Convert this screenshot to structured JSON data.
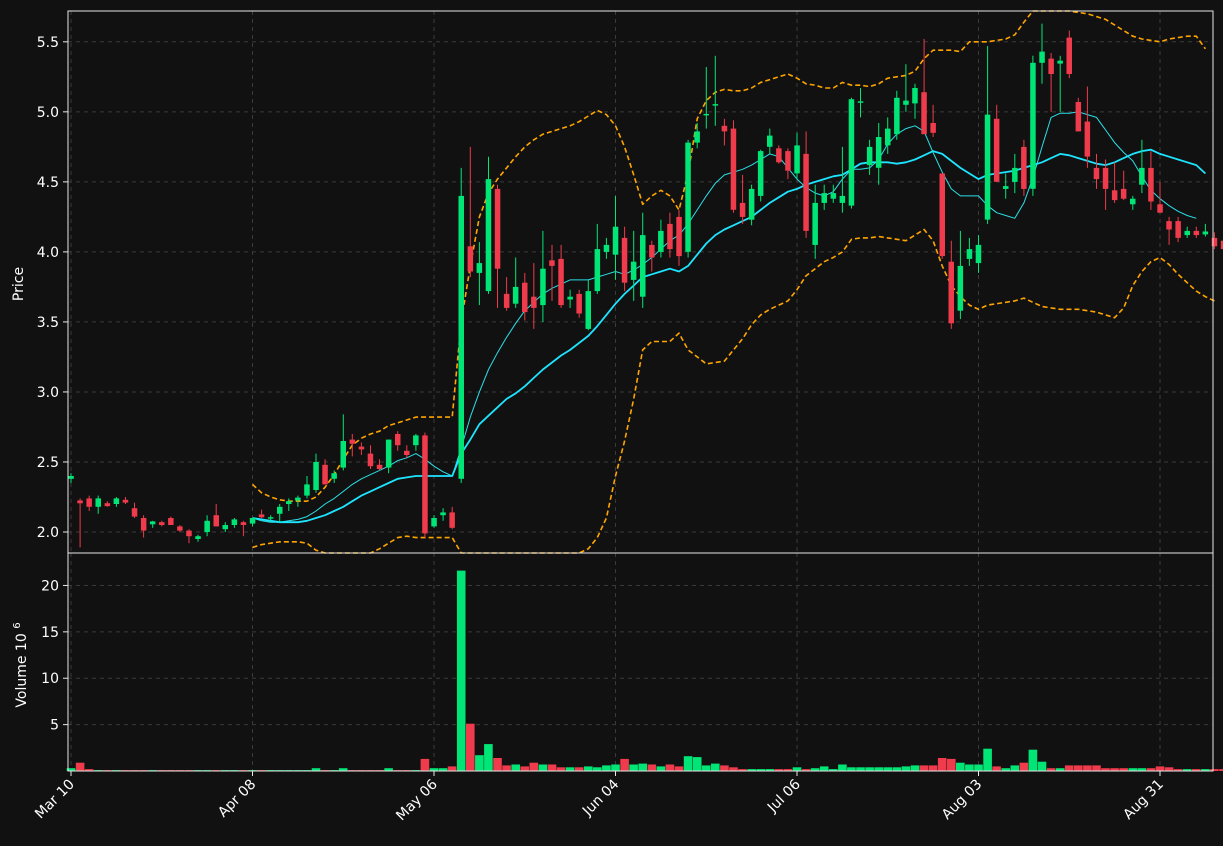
{
  "theme": {
    "background": "#111111",
    "axes_color": "#e8e8e8",
    "grid_color": "#3a3a3a",
    "up_color": "#00e676",
    "down_color": "#ef3b4b",
    "ma_fast_color": "#2be0e8",
    "ma_slow_color": "#1ee5ff",
    "band_color": "#ffa500"
  },
  "chart_data": {
    "type": "candlestick",
    "price_panel": {
      "ylabel": "Price",
      "ylim": [
        1.85,
        5.72
      ],
      "yticks": [
        2.0,
        2.5,
        3.0,
        3.5,
        4.0,
        4.5,
        5.0,
        5.5
      ]
    },
    "volume_panel": {
      "ylabel": "Volume",
      "ylabel_unit_base": "10",
      "ylabel_unit_exp": "6",
      "ylim": [
        0,
        23.5
      ],
      "yticks": [
        5,
        10,
        15,
        20
      ]
    },
    "x_tick_labels": [
      {
        "index": 0,
        "label": "Mar 10"
      },
      {
        "index": 20,
        "label": "Apr 08"
      },
      {
        "index": 40,
        "label": "May 06"
      },
      {
        "index": 60,
        "label": "Jun 04"
      },
      {
        "index": 80,
        "label": "Jul 06"
      },
      {
        "index": 100,
        "label": "Aug 03"
      },
      {
        "index": 120,
        "label": "Aug 31"
      }
    ],
    "grid": true,
    "candles": [
      [
        2.38,
        2.42,
        2.35,
        2.4,
        0.3
      ],
      [
        2.22,
        2.24,
        1.89,
        2.21,
        0.9
      ],
      [
        2.24,
        2.26,
        2.15,
        2.18,
        0.2
      ],
      [
        2.18,
        2.26,
        2.13,
        2.24,
        0.1
      ],
      [
        2.2,
        2.22,
        2.18,
        2.19,
        0.1
      ],
      [
        2.2,
        2.25,
        2.18,
        2.24,
        0.1
      ],
      [
        2.23,
        2.25,
        2.2,
        2.21,
        0.1
      ],
      [
        2.17,
        2.21,
        2.1,
        2.11,
        0.1
      ],
      [
        2.1,
        2.12,
        1.96,
        2.01,
        0.1
      ],
      [
        2.06,
        2.08,
        2.03,
        2.07,
        0.1
      ],
      [
        2.07,
        2.08,
        2.04,
        2.05,
        0.1
      ],
      [
        2.1,
        2.11,
        2.05,
        2.05,
        0.1
      ],
      [
        2.04,
        2.05,
        2.0,
        2.01,
        0.1
      ],
      [
        2.01,
        2.02,
        1.92,
        1.97,
        0.1
      ],
      [
        1.95,
        1.98,
        1.93,
        1.97,
        0.1
      ],
      [
        2.0,
        2.12,
        1.97,
        2.08,
        0.1
      ],
      [
        2.12,
        2.2,
        2.04,
        2.04,
        0.1
      ],
      [
        2.02,
        2.07,
        2.0,
        2.05,
        0.1
      ],
      [
        2.05,
        2.1,
        2.03,
        2.09,
        0.1
      ],
      [
        2.07,
        2.08,
        1.97,
        2.05,
        0.1
      ],
      [
        2.06,
        2.1,
        2.04,
        2.1,
        0.1
      ],
      [
        2.12,
        2.16,
        2.1,
        2.11,
        0.1
      ],
      [
        2.1,
        2.12,
        2.08,
        2.1,
        0.1
      ],
      [
        2.13,
        2.2,
        2.07,
        2.18,
        0.1
      ],
      [
        2.2,
        2.24,
        2.15,
        2.22,
        0.1
      ],
      [
        2.23,
        2.26,
        2.18,
        2.24,
        0.1
      ],
      [
        2.26,
        2.4,
        2.24,
        2.34,
        0.1
      ],
      [
        2.3,
        2.56,
        2.28,
        2.5,
        0.3
      ],
      [
        2.48,
        2.52,
        2.34,
        2.34,
        0.1
      ],
      [
        2.38,
        2.44,
        2.35,
        2.42,
        0.1
      ],
      [
        2.46,
        2.84,
        2.44,
        2.65,
        0.3
      ],
      [
        2.66,
        2.7,
        2.54,
        2.63,
        0.1
      ],
      [
        2.61,
        2.64,
        2.55,
        2.59,
        0.1
      ],
      [
        2.56,
        2.62,
        2.45,
        2.47,
        0.1
      ],
      [
        2.48,
        2.52,
        2.44,
        2.45,
        0.1
      ],
      [
        2.46,
        2.66,
        2.42,
        2.66,
        0.3
      ],
      [
        2.7,
        2.72,
        2.58,
        2.62,
        0.1
      ],
      [
        2.58,
        2.62,
        2.53,
        2.55,
        0.1
      ],
      [
        2.62,
        2.7,
        2.58,
        2.69,
        0.1
      ],
      [
        2.69,
        2.71,
        1.96,
        1.99,
        1.3
      ],
      [
        2.04,
        2.12,
        2.03,
        2.1,
        0.3
      ],
      [
        2.12,
        2.17,
        2.08,
        2.14,
        0.3
      ],
      [
        2.14,
        2.18,
        2.02,
        2.03,
        0.5
      ],
      [
        2.38,
        4.6,
        2.35,
        4.4,
        21.6
      ],
      [
        4.04,
        4.75,
        3.82,
        3.86,
        5.1
      ],
      [
        3.85,
        4.07,
        3.62,
        3.92,
        1.7
      ],
      [
        3.72,
        4.68,
        3.7,
        4.52,
        2.9
      ],
      [
        4.45,
        4.48,
        3.6,
        3.88,
        1.4
      ],
      [
        3.7,
        3.82,
        3.58,
        3.6,
        0.6
      ],
      [
        3.63,
        3.96,
        3.6,
        3.75,
        0.7
      ],
      [
        3.78,
        3.85,
        3.51,
        3.57,
        0.5
      ],
      [
        3.68,
        3.92,
        3.45,
        3.6,
        0.9
      ],
      [
        3.62,
        4.15,
        3.5,
        3.88,
        0.7
      ],
      [
        3.94,
        4.05,
        3.65,
        3.9,
        0.7
      ],
      [
        3.95,
        4.05,
        3.6,
        3.62,
        0.4
      ],
      [
        3.66,
        3.73,
        3.6,
        3.68,
        0.4
      ],
      [
        3.7,
        3.73,
        3.53,
        3.56,
        0.4
      ],
      [
        3.45,
        3.8,
        3.44,
        3.72,
        0.5
      ],
      [
        3.72,
        4.2,
        3.7,
        4.02,
        0.4
      ],
      [
        4.0,
        4.1,
        3.95,
        4.05,
        0.6
      ],
      [
        3.98,
        4.4,
        3.8,
        4.18,
        0.7
      ],
      [
        4.1,
        4.18,
        3.72,
        3.78,
        1.3
      ],
      [
        3.8,
        4.15,
        3.65,
        3.93,
        0.7
      ],
      [
        3.68,
        4.28,
        3.6,
        4.12,
        0.8
      ],
      [
        4.05,
        4.08,
        3.86,
        3.96,
        0.7
      ],
      [
        4.0,
        4.23,
        3.96,
        4.15,
        0.5
      ],
      [
        4.2,
        4.28,
        3.96,
        4.02,
        0.7
      ],
      [
        4.25,
        4.3,
        3.9,
        3.97,
        0.5
      ],
      [
        4.0,
        4.8,
        3.96,
        4.78,
        1.6
      ],
      [
        4.78,
        4.92,
        4.74,
        4.86,
        1.5
      ],
      [
        4.98,
        5.32,
        4.88,
        4.98,
        0.6
      ],
      [
        5.05,
        5.4,
        4.9,
        5.05,
        0.8
      ],
      [
        4.9,
        4.95,
        4.76,
        4.86,
        0.6
      ],
      [
        4.88,
        4.94,
        4.28,
        4.3,
        0.4
      ],
      [
        4.35,
        4.55,
        4.2,
        4.25,
        0.2
      ],
      [
        4.23,
        4.48,
        4.19,
        4.45,
        0.2
      ],
      [
        4.4,
        4.73,
        4.36,
        4.72,
        0.2
      ],
      [
        4.75,
        4.88,
        4.7,
        4.83,
        0.2
      ],
      [
        4.74,
        4.76,
        4.63,
        4.64,
        0.2
      ],
      [
        4.72,
        4.74,
        4.52,
        4.58,
        0.2
      ],
      [
        4.56,
        4.85,
        4.52,
        4.76,
        0.4
      ],
      [
        4.7,
        4.86,
        4.1,
        4.15,
        0.2
      ],
      [
        4.05,
        4.48,
        3.95,
        4.35,
        0.3
      ],
      [
        4.35,
        4.48,
        4.3,
        4.42,
        0.5
      ],
      [
        4.38,
        4.48,
        4.35,
        4.42,
        0.2
      ],
      [
        4.35,
        4.75,
        4.28,
        4.4,
        0.7
      ],
      [
        4.33,
        5.1,
        4.31,
        5.09,
        0.4
      ],
      [
        5.07,
        5.17,
        4.96,
        5.07,
        0.4
      ],
      [
        4.62,
        4.8,
        4.55,
        4.75,
        0.4
      ],
      [
        4.6,
        4.92,
        4.48,
        4.82,
        0.4
      ],
      [
        4.76,
        4.96,
        4.7,
        4.88,
        0.4
      ],
      [
        4.84,
        5.15,
        4.8,
        5.1,
        0.4
      ],
      [
        5.05,
        5.34,
        5.0,
        5.08,
        0.5
      ],
      [
        5.06,
        5.2,
        4.95,
        5.17,
        0.6
      ],
      [
        5.14,
        5.52,
        4.96,
        4.84,
        0.6
      ],
      [
        4.92,
        5.05,
        4.82,
        4.85,
        0.6
      ],
      [
        4.56,
        4.56,
        3.95,
        3.97,
        1.4
      ],
      [
        3.93,
        4.08,
        3.45,
        3.49,
        1.3
      ],
      [
        3.58,
        4.15,
        3.52,
        3.9,
        0.9
      ],
      [
        3.95,
        4.1,
        3.9,
        4.02,
        0.7
      ],
      [
        3.92,
        4.12,
        3.85,
        4.05,
        0.7
      ],
      [
        4.23,
        5.47,
        4.2,
        4.98,
        2.4
      ],
      [
        4.95,
        5.05,
        4.5,
        4.5,
        0.5
      ],
      [
        4.45,
        4.56,
        4.38,
        4.47,
        0.3
      ],
      [
        4.5,
        4.7,
        4.42,
        4.6,
        0.6
      ],
      [
        4.75,
        4.8,
        4.4,
        4.45,
        0.9
      ],
      [
        4.45,
        5.4,
        4.4,
        5.35,
        2.3
      ],
      [
        5.35,
        5.63,
        5.2,
        5.43,
        1.0
      ],
      [
        5.38,
        5.42,
        5.0,
        5.27,
        0.3
      ],
      [
        5.35,
        5.4,
        5.0,
        5.36,
        0.3
      ],
      [
        5.53,
        5.58,
        5.24,
        5.27,
        0.6
      ],
      [
        5.07,
        5.1,
        4.86,
        4.86,
        0.6
      ],
      [
        4.93,
        5.18,
        4.6,
        4.68,
        0.6
      ],
      [
        4.6,
        4.7,
        4.45,
        4.52,
        0.6
      ],
      [
        4.6,
        4.66,
        4.3,
        4.45,
        0.3
      ],
      [
        4.44,
        4.64,
        4.35,
        4.37,
        0.3
      ],
      [
        4.45,
        4.58,
        4.37,
        4.38,
        0.3
      ],
      [
        4.34,
        4.4,
        4.3,
        4.38,
        0.3
      ],
      [
        4.48,
        4.8,
        4.42,
        4.6,
        0.3
      ],
      [
        4.6,
        4.72,
        4.3,
        4.36,
        0.3
      ],
      [
        4.34,
        4.5,
        4.28,
        4.28,
        0.5
      ],
      [
        4.22,
        4.25,
        4.05,
        4.16,
        0.4
      ],
      [
        4.22,
        4.25,
        4.07,
        4.1,
        0.2
      ],
      [
        4.12,
        4.18,
        4.1,
        4.15,
        0.2
      ],
      [
        4.15,
        4.18,
        4.1,
        4.12,
        0.2
      ],
      [
        4.13,
        4.2,
        4.11,
        4.14,
        0.2
      ],
      [
        4.1,
        4.14,
        4.02,
        4.04,
        0.2
      ],
      [
        4.08,
        4.12,
        3.98,
        4.02,
        0.2
      ]
    ],
    "ma_fast": [
      null,
      null,
      null,
      null,
      null,
      null,
      null,
      null,
      null,
      null,
      null,
      null,
      null,
      null,
      null,
      null,
      null,
      null,
      null,
      null,
      2.1,
      2.08,
      2.07,
      2.07,
      2.08,
      2.09,
      2.11,
      2.15,
      2.2,
      2.24,
      2.29,
      2.34,
      2.38,
      2.41,
      2.44,
      2.47,
      2.51,
      2.53,
      2.56,
      2.52,
      2.47,
      2.43,
      2.4,
      2.6,
      2.82,
      3.0,
      3.16,
      3.28,
      3.39,
      3.49,
      3.58,
      3.64,
      3.7,
      3.74,
      3.77,
      3.8,
      3.8,
      3.8,
      3.82,
      3.84,
      3.86,
      3.84,
      3.87,
      3.91,
      3.96,
      4.02,
      4.08,
      4.12,
      4.2,
      4.3,
      4.4,
      4.49,
      4.55,
      4.57,
      4.59,
      4.62,
      4.66,
      4.7,
      4.68,
      4.6,
      4.52,
      4.46,
      4.42,
      4.4,
      4.43,
      4.52,
      4.59,
      4.59,
      4.6,
      4.66,
      4.77,
      4.84,
      4.88,
      4.9,
      4.86,
      4.71,
      4.57,
      4.45,
      4.4,
      4.4,
      4.4,
      4.33,
      4.28,
      4.26,
      4.24,
      4.35,
      4.53,
      4.75,
      4.96,
      4.99,
      4.99,
      5.0,
      4.98,
      4.96,
      4.87,
      4.78,
      4.71,
      4.65,
      4.54,
      4.44,
      4.38,
      4.33,
      4.29,
      4.26,
      4.24
    ],
    "ma_slow": [
      null,
      null,
      null,
      null,
      null,
      null,
      null,
      null,
      null,
      null,
      null,
      null,
      null,
      null,
      null,
      null,
      null,
      null,
      null,
      null,
      2.1,
      2.09,
      2.08,
      2.07,
      2.07,
      2.07,
      2.08,
      2.1,
      2.12,
      2.15,
      2.18,
      2.22,
      2.26,
      2.29,
      2.32,
      2.35,
      2.38,
      2.39,
      2.4,
      2.4,
      2.4,
      2.4,
      2.4,
      2.56,
      2.66,
      2.77,
      2.83,
      2.89,
      2.95,
      2.99,
      3.04,
      3.1,
      3.16,
      3.21,
      3.26,
      3.3,
      3.35,
      3.4,
      3.47,
      3.55,
      3.63,
      3.7,
      3.76,
      3.82,
      3.84,
      3.86,
      3.88,
      3.86,
      3.9,
      3.98,
      4.06,
      4.12,
      4.16,
      4.19,
      4.22,
      4.25,
      4.3,
      4.35,
      4.39,
      4.43,
      4.45,
      4.48,
      4.5,
      4.52,
      4.54,
      4.55,
      4.59,
      4.63,
      4.64,
      4.64,
      4.64,
      4.63,
      4.64,
      4.66,
      4.69,
      4.72,
      4.7,
      4.65,
      4.6,
      4.56,
      4.52,
      4.55,
      4.56,
      4.57,
      4.58,
      4.6,
      4.62,
      4.64,
      4.67,
      4.7,
      4.69,
      4.67,
      4.65,
      4.63,
      4.62,
      4.64,
      4.67,
      4.7,
      4.72,
      4.73,
      4.7,
      4.68,
      4.66,
      4.64,
      4.62,
      4.56
    ],
    "band_upper": [
      null,
      null,
      null,
      null,
      null,
      null,
      null,
      null,
      null,
      null,
      null,
      null,
      null,
      null,
      null,
      null,
      null,
      null,
      null,
      null,
      2.34,
      2.28,
      2.25,
      2.23,
      2.22,
      2.22,
      2.22,
      2.25,
      2.32,
      2.41,
      2.52,
      2.62,
      2.67,
      2.7,
      2.72,
      2.76,
      2.78,
      2.8,
      2.82,
      2.82,
      2.82,
      2.82,
      2.82,
      3.5,
      3.9,
      4.25,
      4.42,
      4.52,
      4.6,
      4.68,
      4.75,
      4.8,
      4.84,
      4.86,
      4.88,
      4.9,
      4.93,
      4.97,
      5.01,
      4.98,
      4.9,
      4.75,
      4.55,
      4.34,
      4.4,
      4.44,
      4.4,
      4.3,
      4.56,
      4.95,
      5.08,
      5.14,
      5.16,
      5.15,
      5.15,
      5.17,
      5.21,
      5.23,
      5.25,
      5.27,
      5.24,
      5.2,
      5.19,
      5.17,
      5.17,
      5.21,
      5.19,
      5.19,
      5.18,
      5.2,
      5.24,
      5.25,
      5.26,
      5.29,
      5.38,
      5.44,
      5.44,
      5.44,
      5.43,
      5.5,
      5.5,
      5.5,
      5.51,
      5.52,
      5.55,
      5.64,
      5.72,
      5.8,
      5.8,
      5.76,
      5.73,
      5.71,
      5.7,
      5.68,
      5.66,
      5.62,
      5.58,
      5.54,
      5.52,
      5.51,
      5.5,
      5.52,
      5.53,
      5.54,
      5.54,
      5.45
    ],
    "band_lower": [
      null,
      null,
      null,
      null,
      null,
      null,
      null,
      null,
      null,
      null,
      null,
      null,
      null,
      null,
      null,
      null,
      null,
      null,
      null,
      null,
      1.89,
      1.91,
      1.92,
      1.93,
      1.93,
      1.93,
      1.92,
      1.87,
      1.82,
      1.79,
      1.79,
      1.79,
      1.82,
      1.85,
      1.88,
      1.92,
      1.96,
      1.97,
      1.96,
      1.96,
      1.96,
      1.96,
      1.96,
      1.45,
      1.35,
      1.25,
      1.2,
      1.18,
      1.18,
      1.2,
      1.25,
      1.32,
      1.42,
      1.52,
      1.62,
      1.72,
      1.8,
      1.88,
      1.96,
      2.1,
      2.4,
      2.65,
      2.95,
      3.3,
      3.36,
      3.36,
      3.36,
      3.42,
      3.3,
      3.25,
      3.2,
      3.21,
      3.22,
      3.3,
      3.38,
      3.48,
      3.55,
      3.59,
      3.62,
      3.65,
      3.73,
      3.83,
      3.88,
      3.93,
      3.96,
      4.0,
      4.09,
      4.1,
      4.1,
      4.11,
      4.1,
      4.09,
      4.08,
      4.12,
      4.16,
      4.08,
      3.9,
      3.76,
      3.68,
      3.62,
      3.59,
      3.62,
      3.63,
      3.64,
      3.65,
      3.67,
      3.64,
      3.61,
      3.6,
      3.59,
      3.59,
      3.59,
      3.58,
      3.57,
      3.55,
      3.53,
      3.6,
      3.76,
      3.86,
      3.93,
      3.96,
      3.91,
      3.84,
      3.78,
      3.72,
      3.68,
      3.65
    ]
  }
}
